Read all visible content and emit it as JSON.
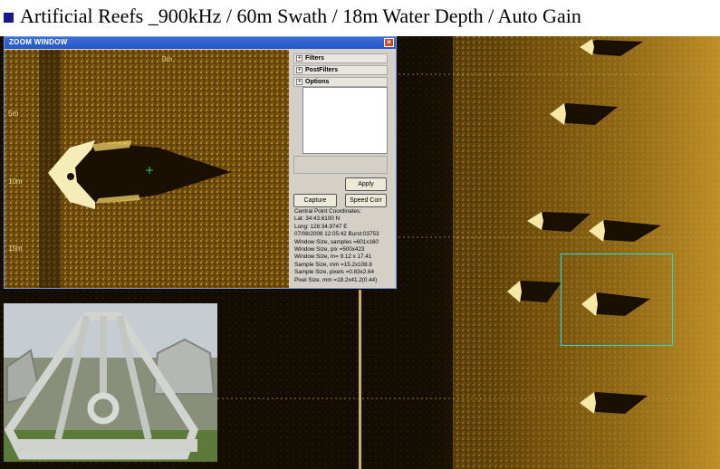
{
  "title": "Artificial Reefs _900kHz / 60m Swath / 18m Water Depth / Auto Gain",
  "zoom_window": {
    "title": "ZOOM WINDOW",
    "depth_labels": [
      "0m",
      "5m",
      "10m",
      "15m"
    ],
    "tree_items": [
      "Filters",
      "PostFilters",
      "Options"
    ],
    "apply_button": "Apply",
    "capture_button": "Capture",
    "speed_corr_button": "Speed Corr",
    "info": {
      "header": "Central Point Coordinates:",
      "lat": "Lat:      34:43.6100 N",
      "long": "Long:   128:34.9747 E",
      "datetime": "07/08/2008 12:05:42 Burst:03753",
      "window_samples": "Window Size, samples =601x160",
      "window_pix": "Window Size, pix =500x423",
      "window_m": "Window Size, m= 9.12 x 17.41",
      "sample_mm": "Sample Size, mm =15.2x108.8",
      "sample_pixels": "Sample Size, pixels =0.83x2.64",
      "pixel_mm": "Pixel Size, mm =18.2x41.2(0.44)"
    }
  },
  "colors": {
    "sonar_gold": "#d6a428",
    "selection_cyan": "#1fe0e0",
    "bullet": "#1a1a8c"
  }
}
